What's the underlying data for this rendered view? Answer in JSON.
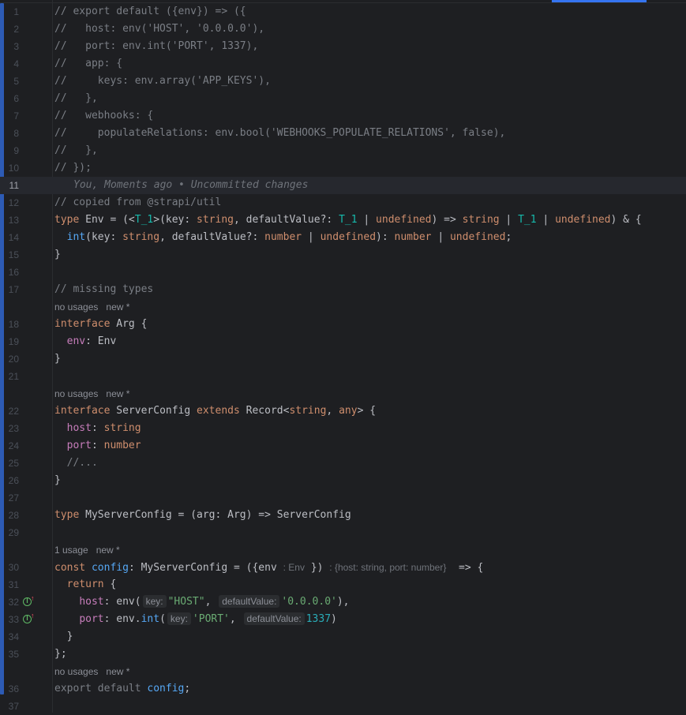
{
  "editor": {
    "gutter_icons": {
      "implements_override": "implements-member-icon"
    },
    "colors": {
      "background": "#1e1f22",
      "keyword": "#cf8e6d",
      "string": "#6aab73",
      "comment": "#7a7e85",
      "property": "#c77dbb",
      "function": "#56a8f5",
      "number": "#2aacb8"
    },
    "lines": {
      "l1": "// export default ({env}) => ({",
      "l2": "//   host: env('HOST', '0.0.0.0'),",
      "l3": "//   port: env.int('PORT', 1337),",
      "l4": "//   app: {",
      "l5": "//     keys: env.array('APP_KEYS'),",
      "l6": "//   },",
      "l7": "//   webhooks: {",
      "l8": "//     populateRelations: env.bool('WEBHOOKS_POPULATE_RELATIONS', false),",
      "l9": "//   },",
      "l10": "// });",
      "l11_blame": "You, Moments ago • Uncommitted changes",
      "l12": "// copied from @strapi/util",
      "l17": "// missing types",
      "l25": "//..."
    },
    "hints": {
      "arg_usages": "no usages",
      "arg_new": "new *",
      "server_config_usages": "no usages",
      "server_config_new": "new *",
      "config_usages": "1 usage",
      "config_new": "new *",
      "export_usages": "no usages",
      "export_new": "new *"
    },
    "inlay": {
      "env_type": ": Env",
      "return_type": ": {host: string, port: number}",
      "key": "key:",
      "default_value": "defaultValue:"
    }
  }
}
